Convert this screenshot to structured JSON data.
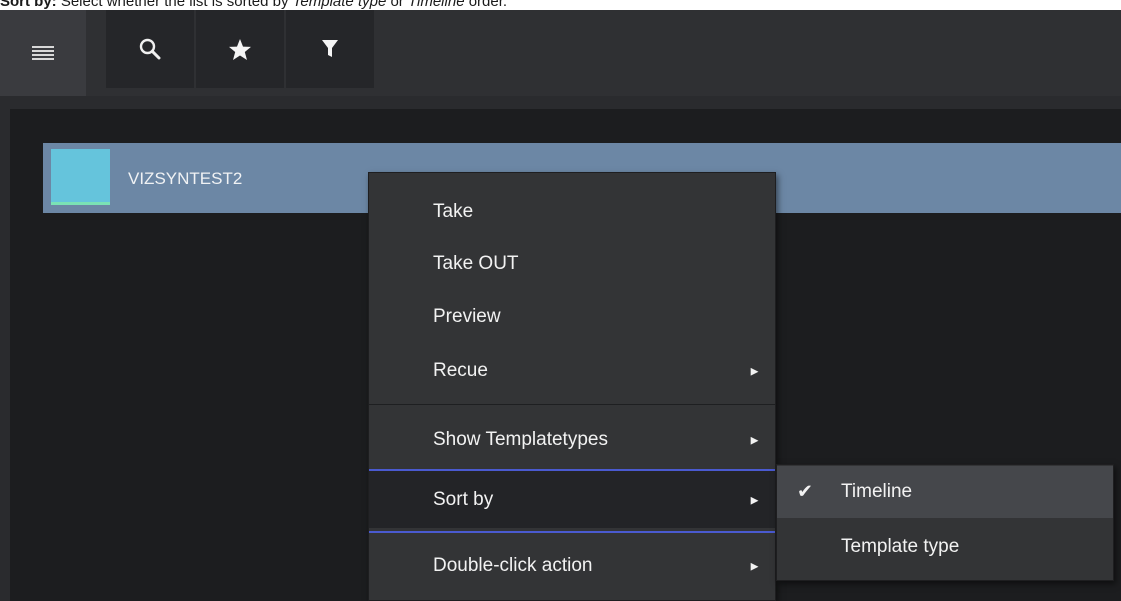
{
  "caption": {
    "bold": "Sort by:",
    "text1": " Select whether the list is sorted by ",
    "italic1": "Template type",
    "text2": " or ",
    "italic2": "Timeline",
    "text3": " order."
  },
  "toolbar": {
    "buttons": [
      {
        "icon": "hamburger-menu-icon"
      },
      {
        "icon": "search-icon"
      },
      {
        "icon": "star-icon"
      },
      {
        "icon": "filter-icon"
      }
    ]
  },
  "list": {
    "items": [
      {
        "label": "VIZSYNTEST2",
        "thumb_color": "#65c4dc"
      }
    ]
  },
  "context_menu": {
    "items": [
      {
        "label": "Take",
        "has_submenu": false
      },
      {
        "label": "Take OUT",
        "has_submenu": false
      },
      {
        "label": "Preview",
        "has_submenu": false
      },
      {
        "label": "Recue",
        "has_submenu": true
      },
      {
        "label": "Show Templatetypes",
        "has_submenu": true
      },
      {
        "label": "Sort by",
        "has_submenu": true,
        "active": true
      },
      {
        "label": "Double-click action",
        "has_submenu": true
      }
    ],
    "arrow_glyph": "►"
  },
  "sort_submenu": {
    "items": [
      {
        "label": "Timeline",
        "checked": true
      },
      {
        "label": "Template type",
        "checked": false
      }
    ],
    "check_glyph": "✔"
  },
  "colors": {
    "app_bg": "#2a2b2e",
    "row_highlight": "#6c87a5",
    "separator_accent": "#4a5ad0"
  }
}
